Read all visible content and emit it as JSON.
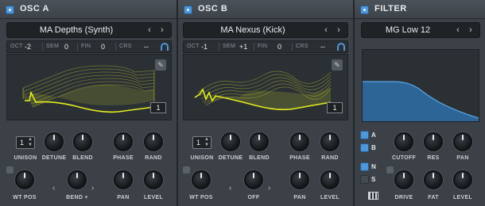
{
  "osc_a": {
    "title": "OSC A",
    "preset": "MA Depths (Synth)",
    "oct_label": "OCT",
    "oct_value": "-2",
    "sem_label": "SEM",
    "sem_value": "0",
    "fin_label": "FIN",
    "fin_value": "0",
    "crs_label": "CRS",
    "crs_value": "--",
    "frame": "1",
    "knobs": {
      "unison_value": "1",
      "unison": "UNISON",
      "detune": "DETUNE",
      "blend": "BLEND",
      "phase": "PHASE",
      "rand": "RAND",
      "wt_pos": "WT POS",
      "bend": "BEND +",
      "pan": "PAN",
      "level": "LEVEL"
    }
  },
  "osc_b": {
    "title": "OSC B",
    "preset": "MA Nexus (Kick)",
    "oct_label": "OCT",
    "oct_value": "-1",
    "sem_label": "SEM",
    "sem_value": "+1",
    "fin_label": "FIN",
    "fin_value": "0",
    "crs_label": "CRS",
    "crs_value": "--",
    "frame": "1",
    "knobs": {
      "unison_value": "1",
      "unison": "UNISON",
      "detune": "DETUNE",
      "blend": "BLEND",
      "phase": "PHASE",
      "rand": "RAND",
      "wt_pos": "WT POS",
      "warp": "OFF",
      "pan": "PAN",
      "level": "LEVEL"
    }
  },
  "filter": {
    "title": "FILTER",
    "preset": "MG Low 12",
    "route_a": "A",
    "route_b": "B",
    "route_n": "N",
    "route_s": "S",
    "knobs": {
      "cutoff": "CUTOFF",
      "res": "RES",
      "pan": "PAN",
      "drive": "DRIVE",
      "fat": "FAT",
      "level": "LEVEL"
    }
  },
  "colors": {
    "accent": "#4f96d6",
    "wavetable": "#c8d12a",
    "filter_curve": "#2f6fa8"
  }
}
